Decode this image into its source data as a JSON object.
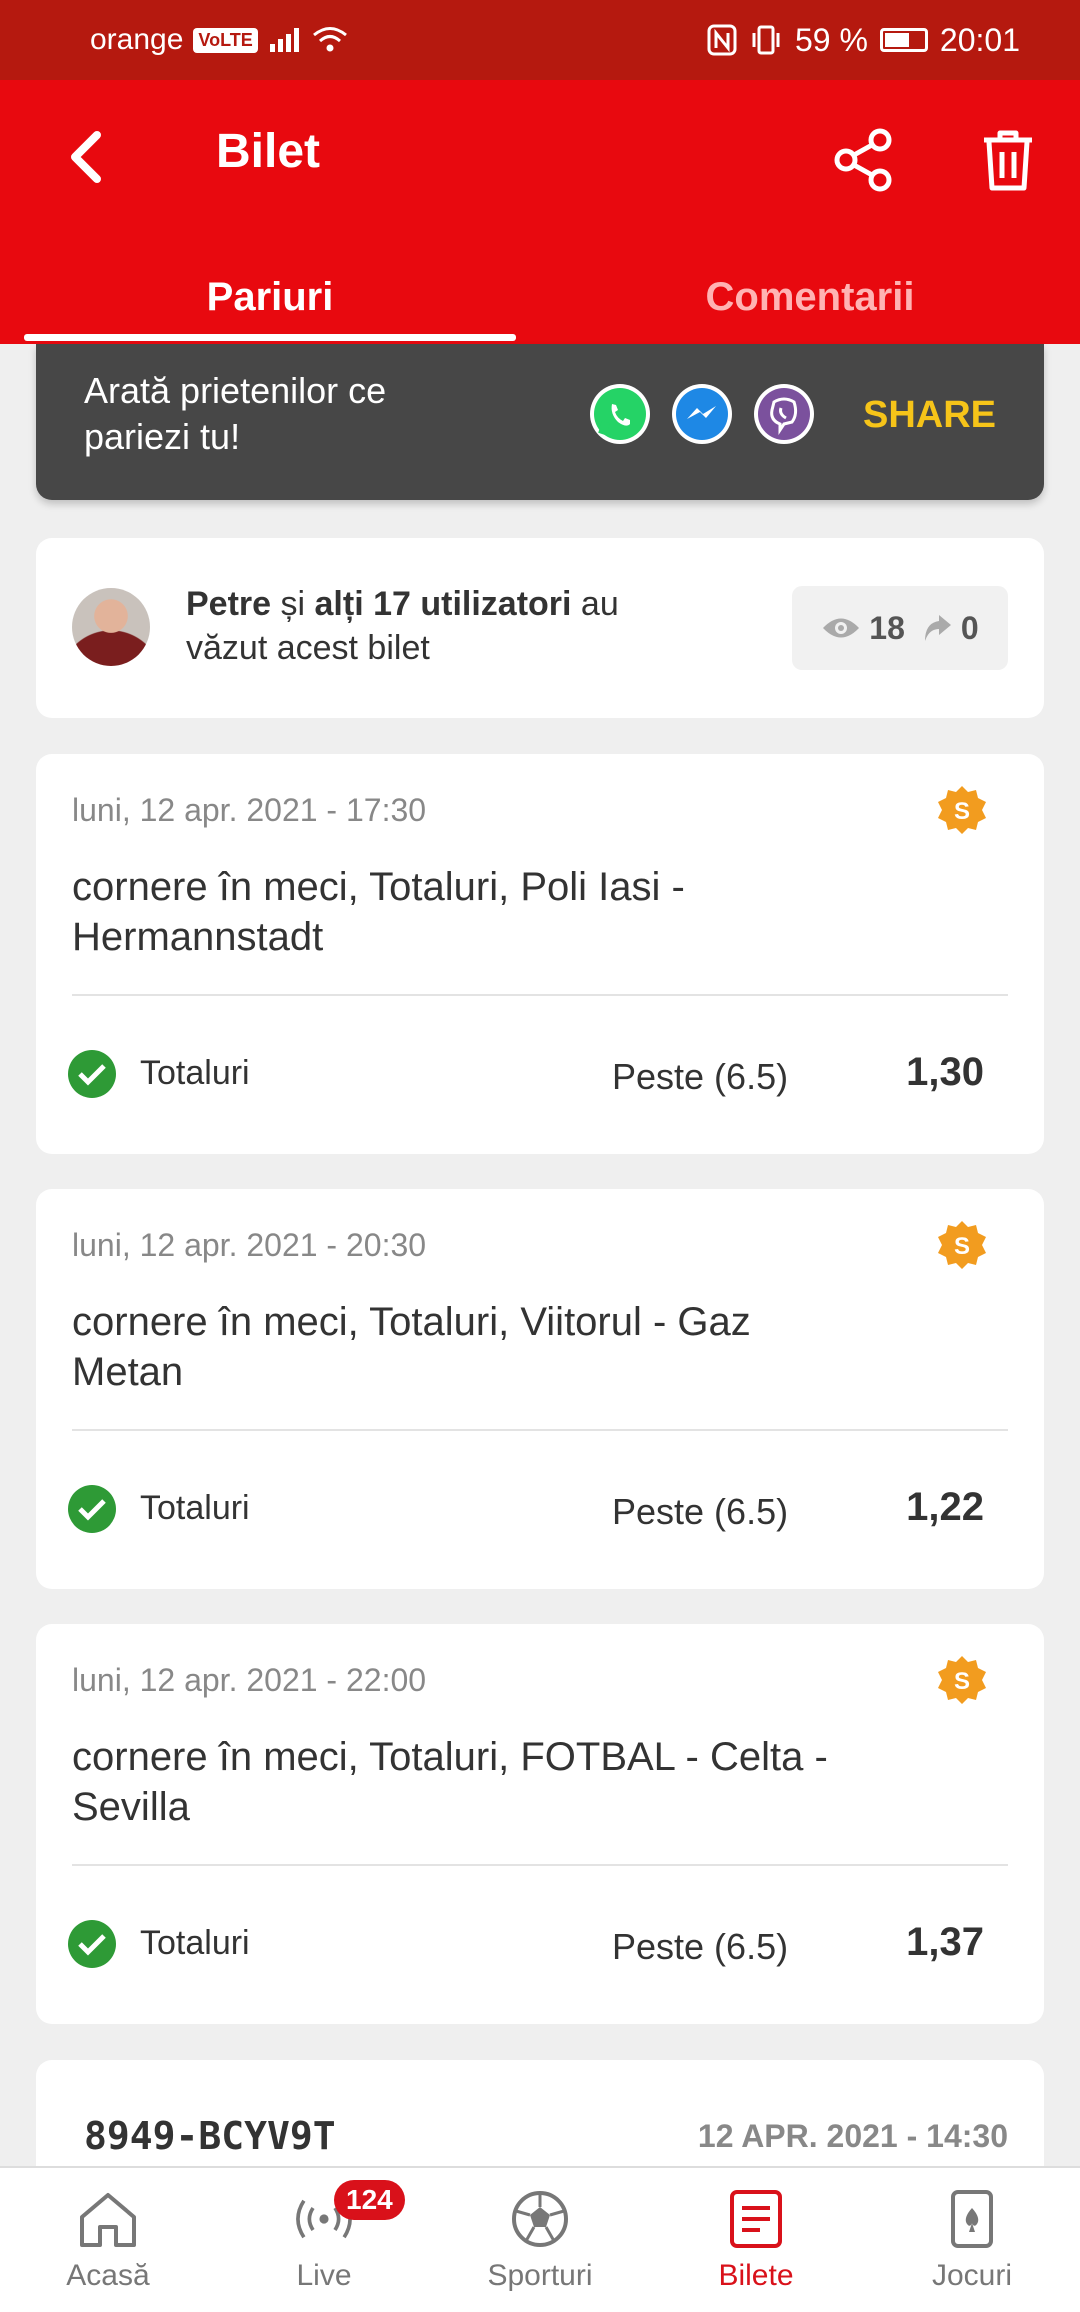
{
  "status_bar": {
    "carrier": "orange",
    "volte": "VoLTE",
    "battery": "59 %",
    "time": "20:01"
  },
  "header": {
    "title": "Bilet"
  },
  "tabs": [
    {
      "label": "Pariuri",
      "active": true
    },
    {
      "label": "Comentarii",
      "active": false
    }
  ],
  "banner": {
    "text": "Arată prietenilor ce pariezi tu!",
    "share_label": "SHARE"
  },
  "viewers": {
    "name": "Petre",
    "connector": " și ",
    "others": "alți 17 utilizatori",
    "suffix": " au văzut acest bilet",
    "views": "18",
    "shares": "0"
  },
  "bets": [
    {
      "date": "luni, 12 apr. 2021 - 17:30",
      "event": "cornere în meci, Totaluri, Poli Iasi - Hermannstadt",
      "market": "Totaluri",
      "selection": "Peste (6.5)",
      "odd": "1,30"
    },
    {
      "date": "luni, 12 apr. 2021 - 20:30",
      "event": "cornere în meci, Totaluri, Viitorul - Gaz Metan",
      "market": "Totaluri",
      "selection": "Peste (6.5)",
      "odd": "1,22"
    },
    {
      "date": "luni, 12 apr. 2021 - 22:00",
      "event": "cornere în meci, Totaluri, FOTBAL - Celta - Sevilla",
      "market": "Totaluri",
      "selection": "Peste (6.5)",
      "odd": "1,37"
    }
  ],
  "ticket": {
    "code": "8949-BCYV9T",
    "date": "12 APR. 2021 - 14:30"
  },
  "nav": [
    {
      "label": "Acasă",
      "icon": "home-icon"
    },
    {
      "label": "Live",
      "icon": "live-icon",
      "badge": "124"
    },
    {
      "label": "Sporturi",
      "icon": "soccer-ball-icon"
    },
    {
      "label": "Bilete",
      "icon": "ticket-icon",
      "active": true
    },
    {
      "label": "Jocuri",
      "icon": "cards-icon"
    }
  ],
  "colors": {
    "primary": "#e8090f",
    "status_bar": "#b5190f",
    "share_accent": "#f6c419",
    "success": "#2e9a36",
    "badge": "#f29c1f"
  }
}
